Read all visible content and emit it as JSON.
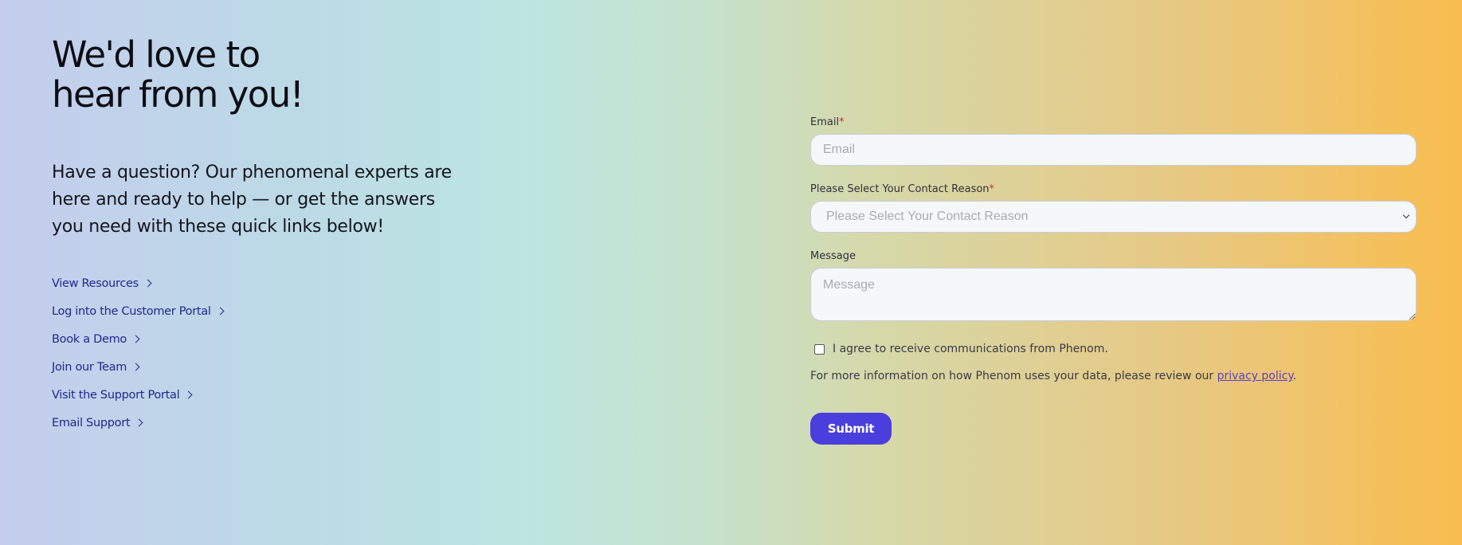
{
  "hero": {
    "heading_line1": "We'd love to",
    "heading_line2": "hear from you!",
    "intro": "Have a question? Our phenomenal experts are here and ready to help — or get the answers you need with these quick links below!"
  },
  "links": [
    {
      "label": "View Resources",
      "icon": "chevron-right-icon"
    },
    {
      "label": "Log into the Customer Portal",
      "icon": "chevron-right-icon"
    },
    {
      "label": "Book a Demo",
      "icon": "chevron-right-icon"
    },
    {
      "label": "Join our Team",
      "icon": "chevron-right-icon"
    },
    {
      "label": "Visit the Support Portal",
      "icon": "chevron-right-icon"
    },
    {
      "label": "Email Support",
      "icon": "chevron-right-icon"
    }
  ],
  "form": {
    "email": {
      "label": "Email",
      "required_mark": "*",
      "placeholder": "Email",
      "value": ""
    },
    "contact_reason": {
      "label": "Please Select Your Contact Reason",
      "required_mark": "*",
      "selected": "Please Select Your Contact Reason"
    },
    "message": {
      "label": "Message",
      "placeholder": "Message",
      "value": ""
    },
    "consent": {
      "label": "I agree to receive communications from Phenom.",
      "checked": false
    },
    "privacy": {
      "text": "For more information on how Phenom uses your data, please review our",
      "link": "privacy policy",
      "suffix": "."
    },
    "submit_label": "Submit"
  },
  "colors": {
    "link": "#1e2a8c",
    "submit": "#4a3fdc",
    "required": "#d8262f",
    "privacy_link": "#5c3fc7",
    "gradient_left": "#c4cdee",
    "gradient_right": "#f9bd4f"
  }
}
